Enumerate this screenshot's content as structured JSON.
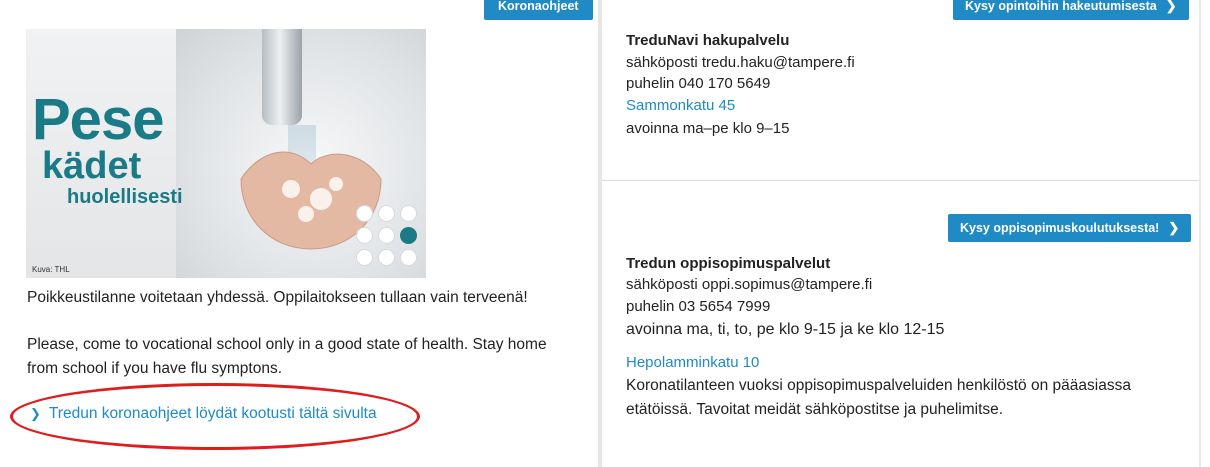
{
  "left": {
    "top_button": "Koronaohjeet",
    "hero": {
      "line1": "Pese",
      "line2": "kädet",
      "line3": "huolellisesti",
      "credit": "Kuva: THL"
    },
    "text_fi": "Poikkeustilanne voitetaan yhdessä. Oppilaitokseen tullaan vain terveenä!",
    "text_en_line1": "Please, come to vocational school only in a good state of health. Stay home",
    "text_en_line2": "from school if you have flu symptons.",
    "link": "Tredun koronaohjeet löydät kootusti tältä sivulta"
  },
  "right_top": {
    "button": "Kysy opintoihin hakeutumisesta",
    "title": "TreduNavi hakupalvelu",
    "email": "sähköposti tredu.haku@tampere.fi",
    "phone": "puhelin 040 170 5649",
    "address": "Sammonkatu 45",
    "hours": "avoinna ma–pe klo 9–15"
  },
  "right_bottom": {
    "button": "Kysy oppisopimuskoulutuksesta!",
    "title": "Tredun oppisopimuspalvelut",
    "email": "sähköposti oppi.sopimus@tampere.fi",
    "phone": "puhelin 03 5654 7999",
    "hours": "avoinna ma, ti, to, pe klo 9-15 ja ke klo 12-15",
    "address": "Hepolamminkatu 10",
    "note_line1": "Koronatilanteen vuoksi oppisopimuspalveluiden henkilöstö on pääasiassa",
    "note_line2": "etätöissä. Tavoitat meidät sähköpostitse ja puhelimitse."
  },
  "colors": {
    "accent": "#1f8ac4",
    "teal": "#1a7a86",
    "highlight": "#e01c1c"
  },
  "icons": {
    "chevron": "chevron-right-icon"
  }
}
